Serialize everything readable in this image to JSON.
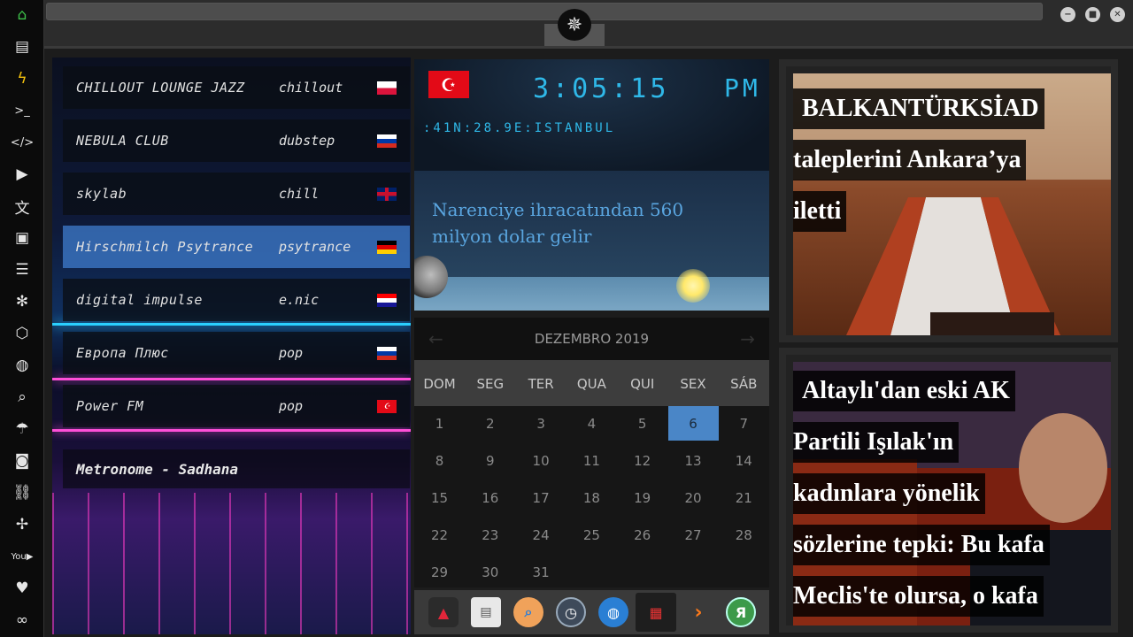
{
  "dock": {
    "icons": [
      "home-icon",
      "document-icon",
      "bolt-icon",
      "terminal-icon",
      "code-icon",
      "play-icon",
      "translate-icon",
      "image-icon",
      "news-icon",
      "rebel-icon",
      "hexagon-icon",
      "globe-icon",
      "search-icon",
      "umbrella-icon",
      "contact-icon",
      "link-icon",
      "expand-icon",
      "youtube-icon",
      "heart-icon",
      "infinity-icon"
    ]
  },
  "radio": {
    "stations": [
      {
        "name": "CHILLOUT LOUNGE JAZZ",
        "genre": "chillout",
        "flag": "poland"
      },
      {
        "name": "NEBULA CLUB",
        "genre": "dubstep",
        "flag": "russia"
      },
      {
        "name": "skylab",
        "genre": "chill",
        "flag": "uk"
      },
      {
        "name": "Hirschmilch Psytrance",
        "genre": "psytrance",
        "flag": "germany"
      },
      {
        "name": "digital impulse",
        "genre": "e.nic",
        "flag": "croatia"
      },
      {
        "name": "Европа Плюс",
        "genre": "pop",
        "flag": "russia"
      },
      {
        "name": "Power FM",
        "genre": "pop",
        "flag": "turkey"
      }
    ],
    "active_index": 3,
    "now_playing": "Metronome - Sadhana"
  },
  "clock": {
    "time": "3:05:15",
    "ampm": "PM",
    "location": ":41N:28.9E:ISTANBUL",
    "news": "Narenciye ihracatından 560 milyon dolar gelir"
  },
  "calendar": {
    "month": "DEZEMBRO 2019",
    "day_names": [
      "DOM",
      "SEG",
      "TER",
      "QUA",
      "QUI",
      "SEX",
      "SÁB"
    ],
    "first_weekday": 0,
    "days_in_month": 31,
    "today": 6
  },
  "appbar": {
    "apps": [
      "arch-icon",
      "browser-icon",
      "search-app-icon",
      "clock-app-icon",
      "globe-app-icon",
      "calendar-app-icon",
      "arrow-app-icon",
      "yandex-icon"
    ]
  },
  "news1": {
    "lines": [
      "BALKANTÜRKSİAD",
      "taleplerini Ankara’ya",
      "iletti"
    ]
  },
  "news2": {
    "lines": [
      "Altaylı'dan eski AK",
      "Partili Işılak'ın",
      "kadınlara yönelik",
      "sözlerine tepki: Bu kafa",
      "Meclis'te olursa, o kafa"
    ]
  }
}
